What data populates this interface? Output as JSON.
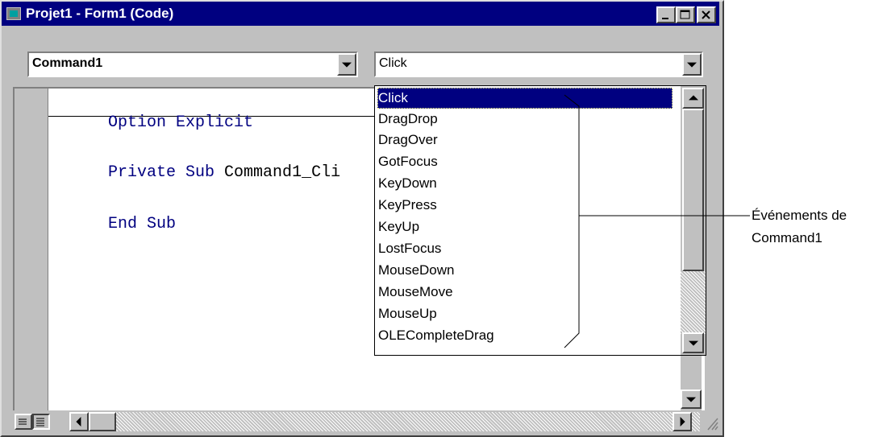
{
  "window": {
    "title": "Projet1 - Form1 (Code)",
    "controls": [
      "minimize",
      "maximize",
      "close"
    ]
  },
  "object_combo": {
    "value": "Command1"
  },
  "procedure_combo": {
    "value": "Click"
  },
  "code": {
    "lines": [
      {
        "keyword": "Option Explicit",
        "rest": ""
      },
      {
        "keyword": "Private Sub",
        "rest": " Command1_Cli"
      },
      {
        "keyword": "End Sub",
        "rest": ""
      }
    ]
  },
  "event_list": {
    "selected": "Click",
    "items": [
      "Click",
      "DragDrop",
      "DragOver",
      "GotFocus",
      "KeyDown",
      "KeyPress",
      "KeyUp",
      "LostFocus",
      "MouseDown",
      "MouseMove",
      "MouseUp",
      "OLECompleteDrag"
    ]
  },
  "annotation": {
    "line1": "Événements de",
    "line2": "Command1"
  },
  "icons": {
    "app": "vb-form-icon",
    "minimize": "minimize-icon",
    "maximize": "maximize-icon",
    "close": "close-icon",
    "procedure_view": "procedure-view-icon",
    "full_module_view": "full-module-view-icon"
  },
  "colors": {
    "titlebar": "#000080",
    "keyword": "#000080",
    "selection": "#000080",
    "face": "#c0c0c0"
  }
}
